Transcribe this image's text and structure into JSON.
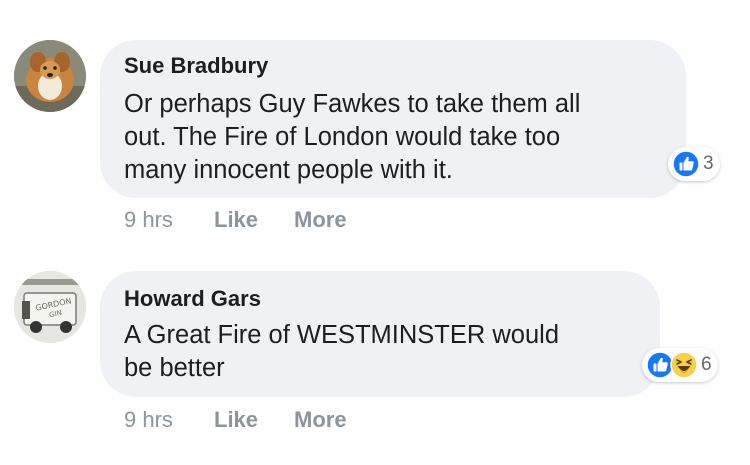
{
  "comments": [
    {
      "author": "Sue Bradbury",
      "text": "Or perhaps Guy Fawkes to take them all out. The Fire of London would take too many innocent people with it.",
      "lines": [
        "Or perhaps Guy Fawkes to take them all",
        "out. The Fire of London would take too",
        "many innocent people with it."
      ],
      "reactions": {
        "icons": [
          "like-icon"
        ],
        "count": "3"
      },
      "time": "9 hrs",
      "like_label": "Like",
      "more_label": "More"
    },
    {
      "author": "Howard Gars",
      "text": "A Great Fire of WESTMINSTER would be better",
      "lines": [
        "A Great Fire of WESTMINSTER would",
        "be better"
      ],
      "reactions": {
        "icons": [
          "like-icon",
          "haha-icon"
        ],
        "count": "6"
      },
      "time": "9 hrs",
      "like_label": "Like",
      "more_label": "More"
    }
  ],
  "colors": {
    "bubble": "#f0f1f4",
    "like_blue": "#1877f2",
    "haha_yellow": "#f7d04b",
    "meta_gray": "#8d949e"
  }
}
